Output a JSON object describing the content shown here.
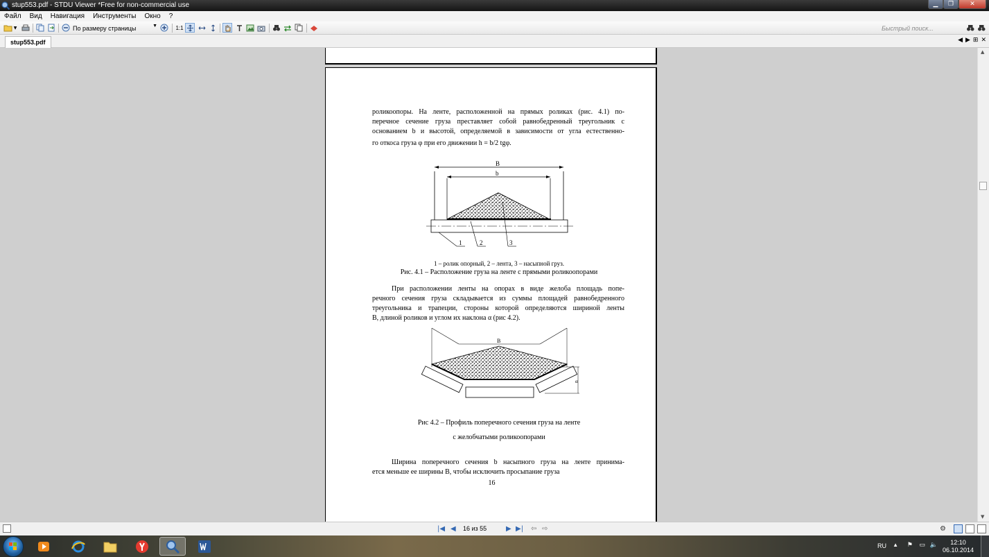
{
  "window": {
    "title": "stup553.pdf - STDU Viewer *Free for non-commercial use"
  },
  "menu": [
    "Файл",
    "Вид",
    "Навигация",
    "Инструменты",
    "Окно",
    "?"
  ],
  "toolbar": {
    "zoom_label": "По размеру страницы",
    "actual_size": "1:1",
    "search_placeholder": "Быстрый поиск..."
  },
  "tabs": [
    {
      "label": "stup553.pdf"
    }
  ],
  "page": {
    "intro_lines": [
      "роликоопоры. На ленте, расположенной на прямых роликах (рис. 4.1) по-",
      "перечное сечение груза преставляет собой равнобедренный треугольник с",
      "основанием b и высотой, определяемой в зависимости от угла естественно-",
      "го откоса груза φ при его движении h = b/2 tgφ."
    ],
    "fig1": {
      "dim_outer": "B",
      "dim_inner": "b",
      "callouts": [
        "1",
        "2",
        "3"
      ]
    },
    "fig1_legend": "1 – ролик опорный, 2 – лента, 3 – насыпной груз.",
    "fig1_caption": "Рис. 4.1 – Расположение груза на ленте с прямыми роликоопорами",
    "para2_lines": [
      "При расположении ленты на опорах в виде желоба площадь попе-",
      "речного сечения груза складывается из суммы площадей равнобедренного",
      "треугольника и трапеции, стороны которой определяются шириной ленты",
      "B, длиной роликов и углом их наклона α (рис 4.2)."
    ],
    "fig2": {
      "dim": "B",
      "angle": "α"
    },
    "fig2_caption_lines": [
      "Рис 4.2 – Профиль поперечного сечения груза на ленте",
      "с желобчатыми роликоопорами"
    ],
    "para3_lines": [
      "Ширина поперечного сечения b насыпного груза на ленте принима-",
      "ется меньше ее ширины B, чтобы исключить просыпание груза"
    ],
    "page_number": "16"
  },
  "nav": {
    "page_counter": "16 из 55"
  },
  "taskbar": {
    "lang": "RU",
    "time": "12:10",
    "date": "06.10.2014"
  }
}
